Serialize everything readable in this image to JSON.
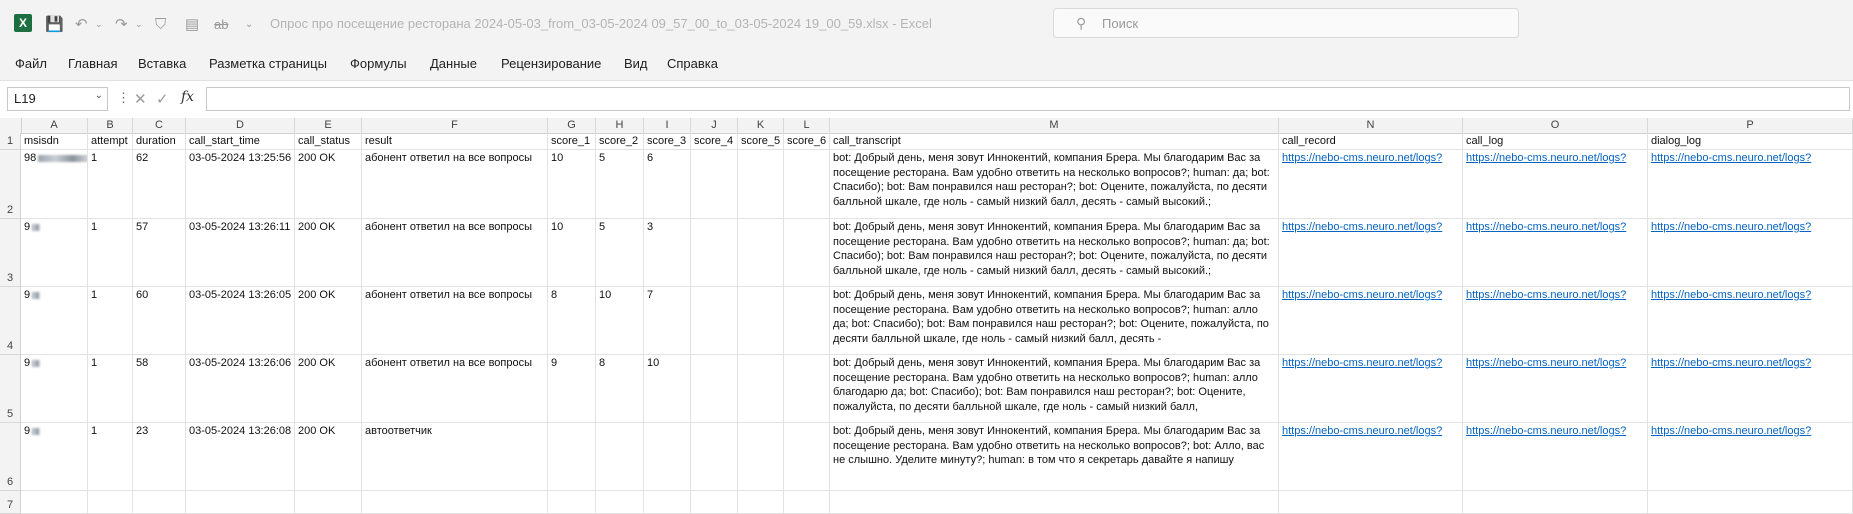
{
  "window": {
    "title": "Опрос про посещение ресторана 2024-05-03_from_03-05-2024 09_57_00_to_03-05-2024 19_00_59.xlsx  -  Excel",
    "search_placeholder": "Поиск"
  },
  "menu": [
    "Файл",
    "Главная",
    "Вставка",
    "Разметка страницы",
    "Формулы",
    "Данные",
    "Рецензирование",
    "Вид",
    "Справка"
  ],
  "formula_bar": {
    "name_box": "L19",
    "fx": "fx",
    "formula": ""
  },
  "columns": [
    "A",
    "B",
    "C",
    "D",
    "E",
    "F",
    "G",
    "H",
    "I",
    "J",
    "K",
    "L",
    "M",
    "N",
    "O",
    "P"
  ],
  "row_numbers": [
    "1",
    "2",
    "3",
    "4",
    "5",
    "6",
    "7"
  ],
  "headers": [
    "msisdn",
    "attempt",
    "duration",
    "call_start_time",
    "call_status",
    "result",
    "score_1",
    "score_2",
    "score_3",
    "score_4",
    "score_5",
    "score_6",
    "call_transcript",
    "call_record",
    "call_log",
    "dialog_log"
  ],
  "rows": [
    {
      "msisdn": "98",
      "attempt": "1",
      "duration": "62",
      "call_start_time": "03-05-2024 13:25:56",
      "call_status": "200 OK",
      "result": "абонент ответил на все вопросы",
      "score_1": "10",
      "score_2": "5",
      "score_3": "6",
      "score_4": "",
      "score_5": "",
      "score_6": "",
      "call_transcript": "bot: Добрый день, меня зовут Иннокентий, компания Брера. Мы благодарим Вас за посещение ресторана. Вам удобно ответить на несколько вопросов?; human: да; bot: Спасибо); bot: Вам понравился наш ресторан?; bot: Оцените, пожалуйста, по десяти балльной шкале, где ноль - самый низкий балл, десять - самый высокий.;",
      "call_record": "https://nebo-cms.neuro.net/logs?",
      "call_log": "https://nebo-cms.neuro.net/logs?",
      "dialog_log": "https://nebo-cms.neuro.net/logs?"
    },
    {
      "msisdn": "9",
      "attempt": "1",
      "duration": "57",
      "call_start_time": "03-05-2024 13:26:11",
      "call_status": "200 OK",
      "result": "абонент ответил на все вопросы",
      "score_1": "10",
      "score_2": "5",
      "score_3": "3",
      "score_4": "",
      "score_5": "",
      "score_6": "",
      "call_transcript": "bot: Добрый день, меня зовут Иннокентий, компания Брера. Мы благодарим Вас за посещение ресторана. Вам удобно ответить на несколько вопросов?; human: да; bot: Спасибо); bot: Вам понравился наш ресторан?; bot: Оцените, пожалуйста, по десяти балльной шкале, где ноль - самый низкий балл, десять - самый высокий.;",
      "call_record": "https://nebo-cms.neuro.net/logs?",
      "call_log": "https://nebo-cms.neuro.net/logs?",
      "dialog_log": "https://nebo-cms.neuro.net/logs?"
    },
    {
      "msisdn": "9",
      "attempt": "1",
      "duration": "60",
      "call_start_time": "03-05-2024 13:26:05",
      "call_status": "200 OK",
      "result": "абонент ответил на все вопросы",
      "score_1": "8",
      "score_2": "10",
      "score_3": "7",
      "score_4": "",
      "score_5": "",
      "score_6": "",
      "call_transcript": "bot: Добрый день, меня зовут Иннокентий, компания Брера. Мы благодарим Вас за посещение ресторана. Вам удобно ответить на несколько вопросов?; human: алло да; bot: Спасибо); bot: Вам понравился наш ресторан?; bot: Оцените, пожалуйста, по десяти балльной шкале, где ноль - самый низкий балл, десять -",
      "call_record": "https://nebo-cms.neuro.net/logs?",
      "call_log": "https://nebo-cms.neuro.net/logs?",
      "dialog_log": "https://nebo-cms.neuro.net/logs?"
    },
    {
      "msisdn": "9",
      "attempt": "1",
      "duration": "58",
      "call_start_time": "03-05-2024 13:26:06",
      "call_status": "200 OK",
      "result": "абонент ответил на все вопросы",
      "score_1": "9",
      "score_2": "8",
      "score_3": "10",
      "score_4": "",
      "score_5": "",
      "score_6": "",
      "call_transcript": "bot: Добрый день, меня зовут Иннокентий, компания Брера. Мы благодарим Вас за посещение ресторана. Вам удобно ответить на несколько вопросов?; human: алло благодарю да; bot: Спасибо); bot: Вам понравился наш ресторан?; bot: Оцените, пожалуйста, по десяти балльной шкале, где ноль - самый низкий балл,",
      "call_record": "https://nebo-cms.neuro.net/logs?",
      "call_log": "https://nebo-cms.neuro.net/logs?",
      "dialog_log": "https://nebo-cms.neuro.net/logs?"
    },
    {
      "msisdn": "9",
      "attempt": "1",
      "duration": "23",
      "call_start_time": "03-05-2024 13:26:08",
      "call_status": "200 OK",
      "result": "автоответчик",
      "score_1": "",
      "score_2": "",
      "score_3": "",
      "score_4": "",
      "score_5": "",
      "score_6": "",
      "call_transcript": "bot: Добрый день, меня зовут Иннокентий, компания Брера. Мы благодарим Вас за посещение ресторана. Вам удобно ответить на несколько вопросов?; bot: Алло, вас не слышно. Уделите минуту?; human: в том что я секретарь давайте я напишу",
      "call_record": "https://nebo-cms.neuro.net/logs?",
      "call_log": "https://nebo-cms.neuro.net/logs?",
      "dialog_log": "https://nebo-cms.neuro.net/logs?"
    }
  ]
}
